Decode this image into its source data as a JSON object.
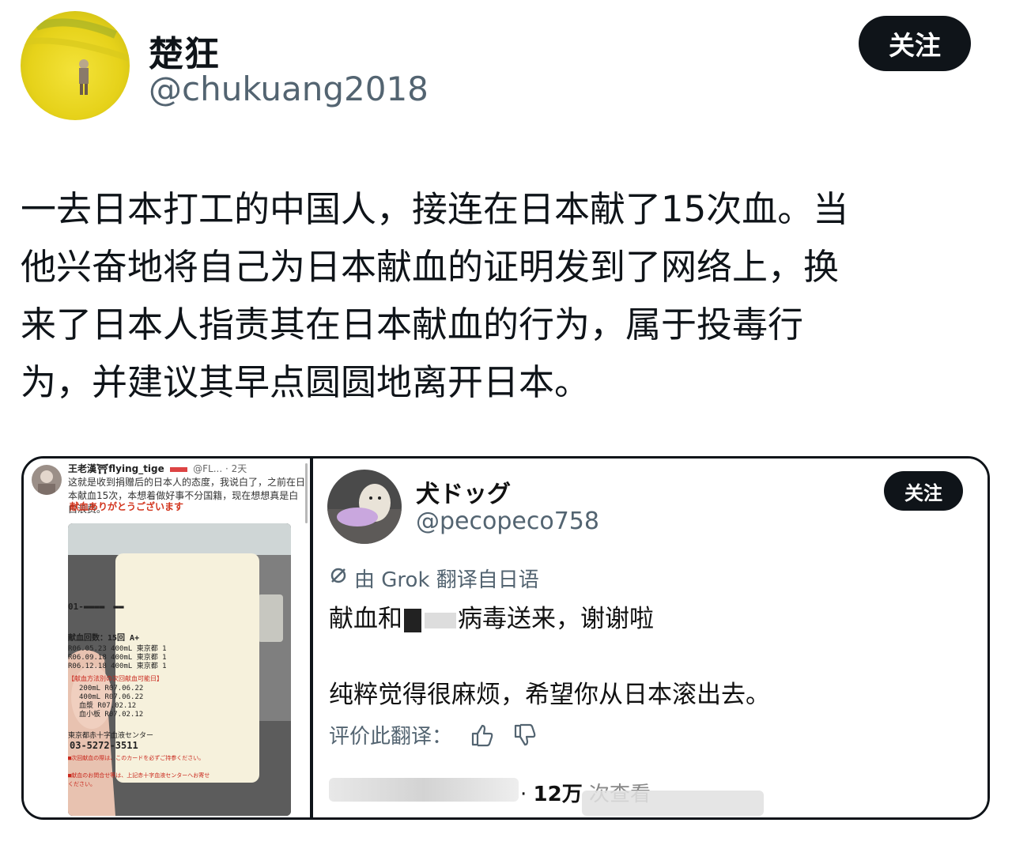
{
  "author": {
    "display_name": "楚狂",
    "handle": "@chukuang2018",
    "follow_label": "关注"
  },
  "tweet": {
    "lines": [
      "一去日本打工的中国人，接连在日本献了15次血。当",
      "他兴奋地将自己为日本献血的证明发到了网络上，换",
      "来了日本人指责其在日本献血的行为，属于投毒行",
      "为，并建议其早点圆圆地离开日本。"
    ]
  },
  "embedded_left": {
    "name": "王老漢⛩flying_tige",
    "meta": "@FL... · 2天",
    "text": "这就是收到捐赠后的日本人的态度，我说白了，之前在日本献血15次，本想着做好事不分国籍，现在想想真是白白浪费。",
    "card": {
      "title": "献血ありがとうございます",
      "id": "01-",
      "count": "献血回数：15回  A+",
      "records": [
        "R06.05.23 400mL  東京都  1",
        "R06.09.18 400mL  東京都  1",
        "R06.12.18 400mL  東京都  1"
      ],
      "next_header": "【献血方法別の次回献血可能日】",
      "next": [
        "200mL   R07.06.22",
        "400mL   R07.06.22",
        "血漿    R07.02.12",
        "血小板  R07.02.12"
      ],
      "center": "東京都赤十字血液センター",
      "phone": "03-5272-3511",
      "note1": "■次回献血の際は、このカードを必ずご持参ください。",
      "note2": "■献血のお問合せ等は、上記赤十字血液センターへお寄せください。"
    }
  },
  "embedded_right": {
    "display_name": "犬ドッグ",
    "handle": "@pecopeco758",
    "follow_label": "关注",
    "translated_by": "由 Grok 翻译自日语",
    "line1": "献血和",
    "line1_tail": "病毒送来，谢谢啦",
    "line2": "纯粹觉得很麻烦，希望你从日本滚出去。",
    "rate_label": "评价此翻译：",
    "views_num": "12万",
    "views_label": "次查看"
  },
  "icons": {
    "avatar": "avatar",
    "thumbs_up": "thumbs-up-icon",
    "thumbs_down": "thumbs-down-icon",
    "grok": "grok-icon"
  }
}
